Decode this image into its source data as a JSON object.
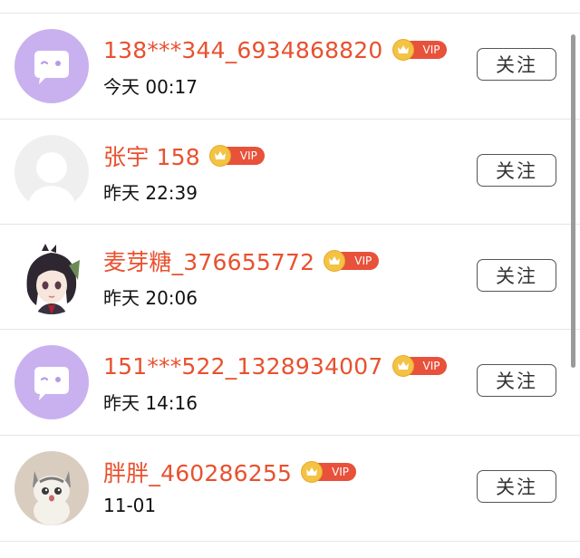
{
  "follow_list": {
    "items": [
      {
        "name": "138***344_6934868820",
        "vip_label": "VIP",
        "time": "今天 00:17",
        "follow_label": "关注",
        "avatar": "default-chat-avatar"
      },
      {
        "name": "张宇 158",
        "vip_label": "VIP",
        "time": "昨天 22:39",
        "follow_label": "关注",
        "avatar": "empty-profile-avatar"
      },
      {
        "name": "麦芽糖_376655772",
        "vip_label": "VIP",
        "time": "昨天 20:06",
        "follow_label": "关注",
        "avatar": "anime-girl-avatar"
      },
      {
        "name": "151***522_1328934007",
        "vip_label": "VIP",
        "time": "昨天 14:16",
        "follow_label": "关注",
        "avatar": "default-chat-avatar"
      },
      {
        "name": "胖胖_460286255",
        "vip_label": "VIP",
        "time": "11-01",
        "follow_label": "关注",
        "avatar": "cat-avatar"
      }
    ]
  },
  "colors": {
    "name": "#e8512f",
    "vip_pill": "#e8513a",
    "vip_crown": "#f3c343",
    "default_avatar_bg": "#c9b1f0"
  }
}
